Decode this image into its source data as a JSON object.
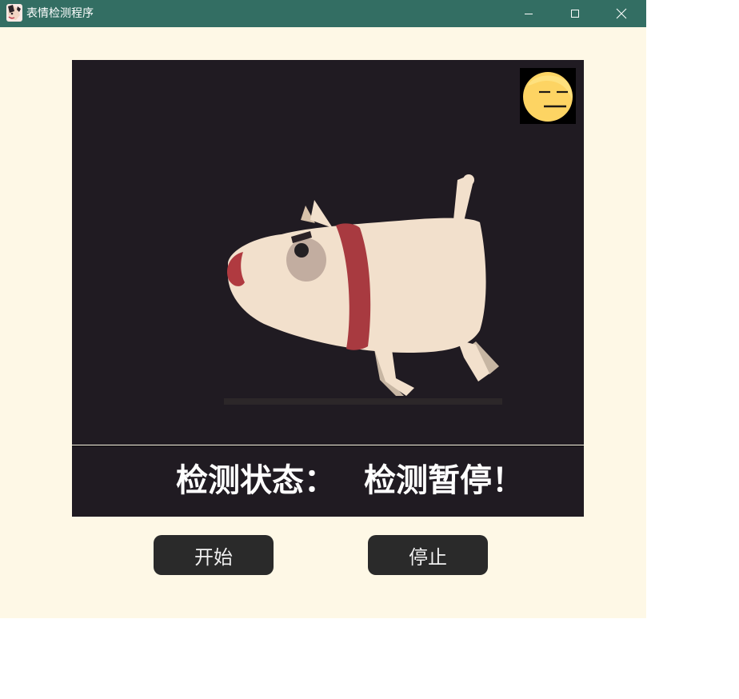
{
  "window": {
    "title": "表情检测程序",
    "app_icon": "dog-avatar-icon",
    "controls": {
      "minimize_icon": "minimize-icon",
      "maximize_icon": "maximize-icon",
      "close_icon": "close-icon"
    }
  },
  "video": {
    "content": "dog-illustration",
    "emotion_icon": "neutral-face-emoji-icon"
  },
  "status": {
    "label": "检测状态：",
    "value": "检测暂停！"
  },
  "buttons": {
    "start_label": "开始",
    "stop_label": "停止"
  },
  "colors": {
    "titlebar": "#336e63",
    "window_bg": "#fef8e6",
    "panel_bg": "#201b22",
    "button_bg": "#2a2a2a",
    "collar": "#a83a40",
    "dog_body": "#f2e0cc"
  }
}
